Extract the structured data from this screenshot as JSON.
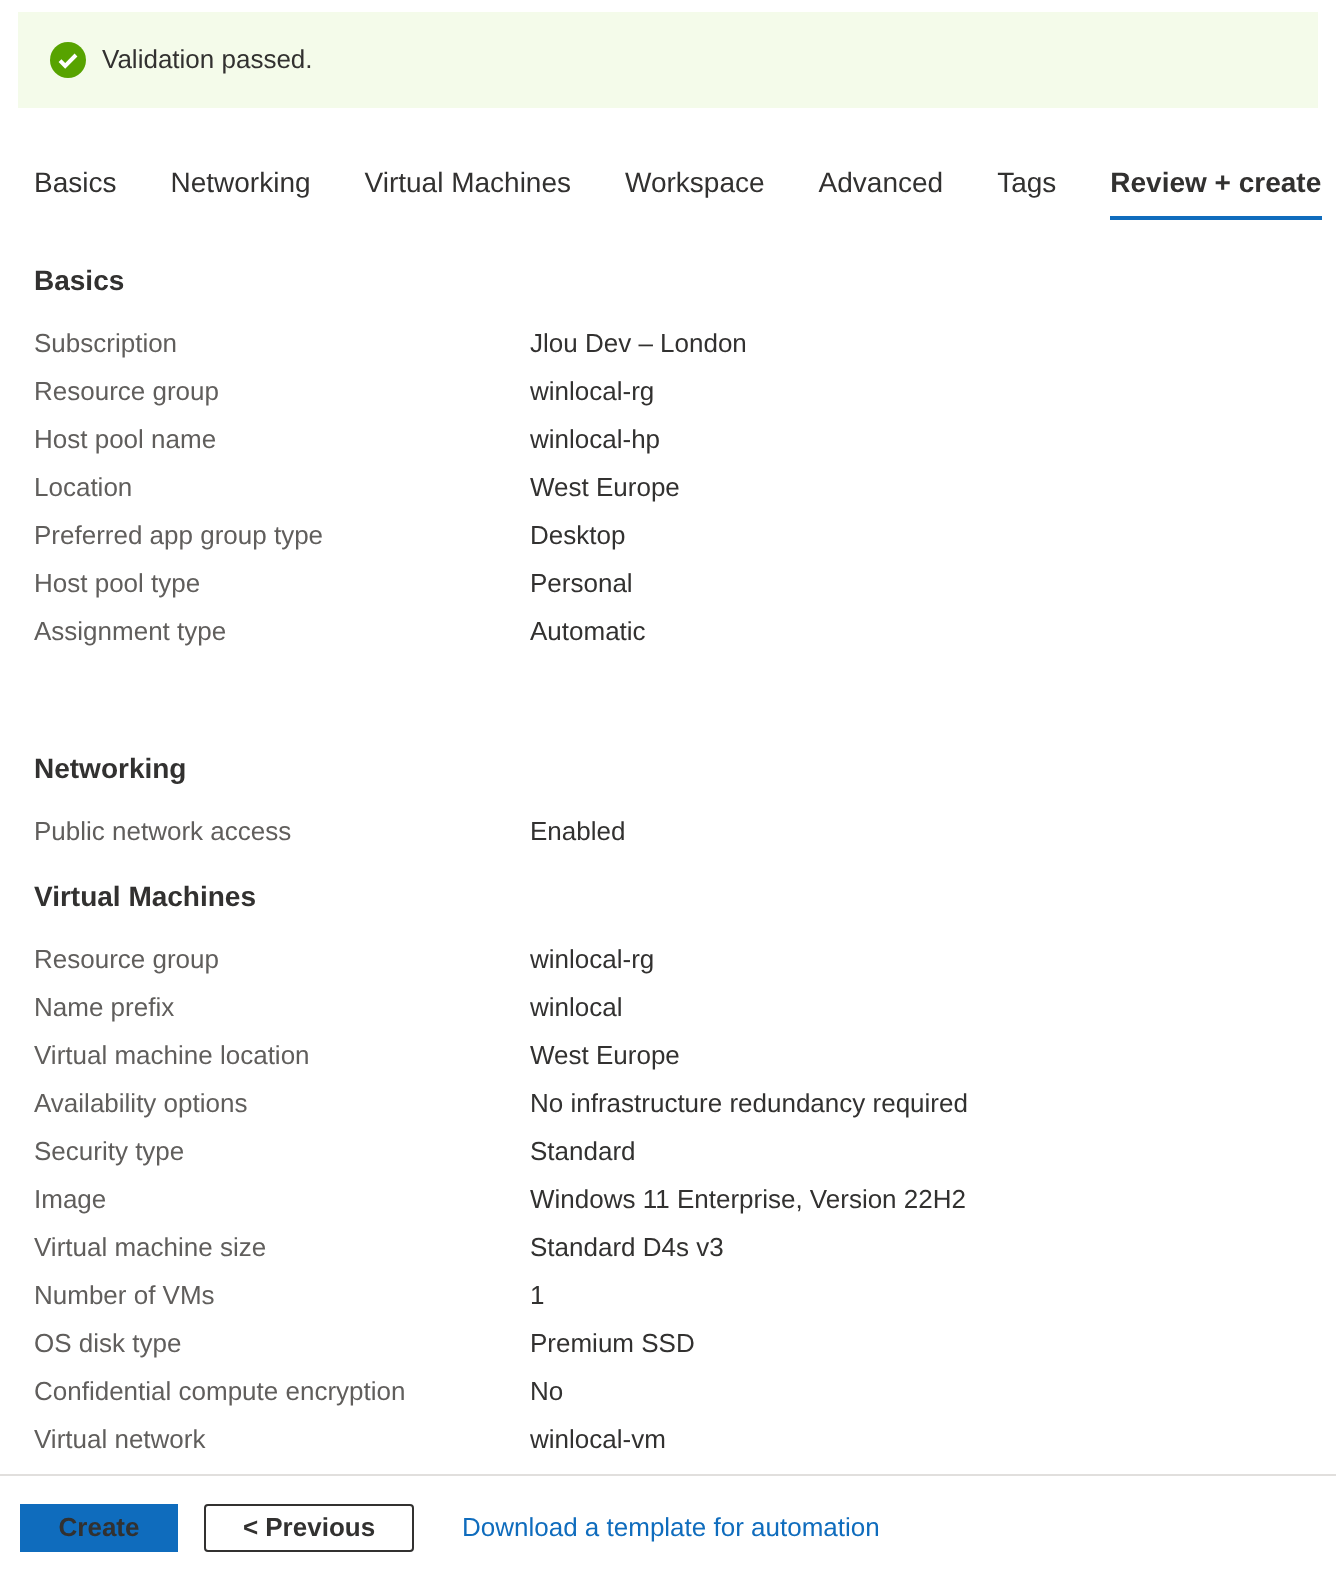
{
  "banner": {
    "kind": "success",
    "text": "Validation passed."
  },
  "tabs": [
    {
      "label": "Basics",
      "selected": false
    },
    {
      "label": "Networking",
      "selected": false
    },
    {
      "label": "Virtual Machines",
      "selected": false
    },
    {
      "label": "Workspace",
      "selected": false
    },
    {
      "label": "Advanced",
      "selected": false
    },
    {
      "label": "Tags",
      "selected": false
    },
    {
      "label": "Review + create",
      "selected": true
    }
  ],
  "sections": [
    {
      "title": "Basics",
      "rows": [
        {
          "label": "Subscription",
          "value": "Jlou Dev – London"
        },
        {
          "label": "Resource group",
          "value": "winlocal-rg"
        },
        {
          "label": "Host pool name",
          "value": "winlocal-hp"
        },
        {
          "label": "Location",
          "value": "West Europe"
        },
        {
          "label": "Preferred app group type",
          "value": "Desktop"
        },
        {
          "label": "Host pool type",
          "value": "Personal"
        },
        {
          "label": "Assignment type",
          "value": "Automatic"
        }
      ]
    },
    {
      "title": "Networking",
      "rows": [
        {
          "label": "Public network access",
          "value": "Enabled"
        }
      ]
    },
    {
      "title": "Virtual Machines",
      "rows": [
        {
          "label": "Resource group",
          "value": "winlocal-rg"
        },
        {
          "label": "Name prefix",
          "value": "winlocal"
        },
        {
          "label": "Virtual machine location",
          "value": "West Europe"
        },
        {
          "label": "Availability options",
          "value": "No infrastructure redundancy required"
        },
        {
          "label": "Security type",
          "value": "Standard"
        },
        {
          "label": "Image",
          "value": "Windows 11 Enterprise, Version 22H2"
        },
        {
          "label": "Virtual machine size",
          "value": "Standard D4s v3"
        },
        {
          "label": "Number of VMs",
          "value": "1"
        },
        {
          "label": "OS disk type",
          "value": "Premium SSD"
        },
        {
          "label": "Confidential compute encryption",
          "value": "No"
        },
        {
          "label": "Virtual network",
          "value": "winlocal-vm"
        }
      ]
    }
  ],
  "footer": {
    "create": "Create",
    "previous": "< Previous",
    "link": "Download a template for automation"
  }
}
